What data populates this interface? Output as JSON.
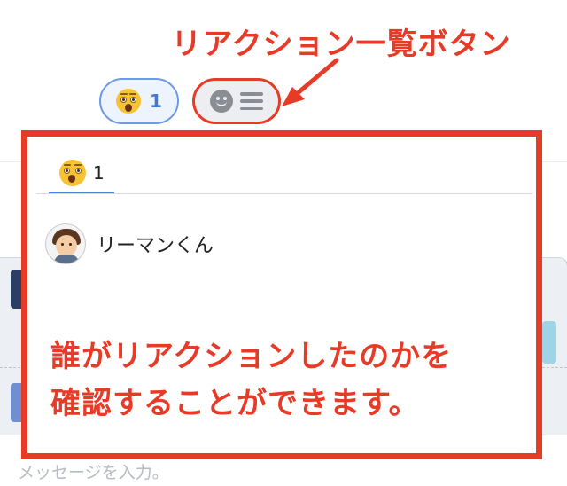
{
  "annotation": {
    "title": "リアクション一覧ボタン",
    "body_line1": "誰がリアクションしたのかを",
    "body_line2": "確認することができます。",
    "color": "#e53b27"
  },
  "reaction_bar": {
    "reaction_chip": {
      "icon": "astonished-face-emoji-icon",
      "count": "1"
    },
    "list_button": {
      "icons": [
        "smiley-icon",
        "menu-lines-icon"
      ]
    }
  },
  "popup": {
    "tabs": [
      {
        "icon": "astonished-face-emoji-icon",
        "count": "1",
        "selected": true
      }
    ],
    "users": [
      {
        "name": "リーマンくん",
        "avatar": "user-avatar-icon"
      }
    ]
  },
  "composer": {
    "placeholder": "メッセージを入力。"
  },
  "colors": {
    "accent_blue": "#4f7fd8",
    "highlight_red": "#e53b27"
  }
}
